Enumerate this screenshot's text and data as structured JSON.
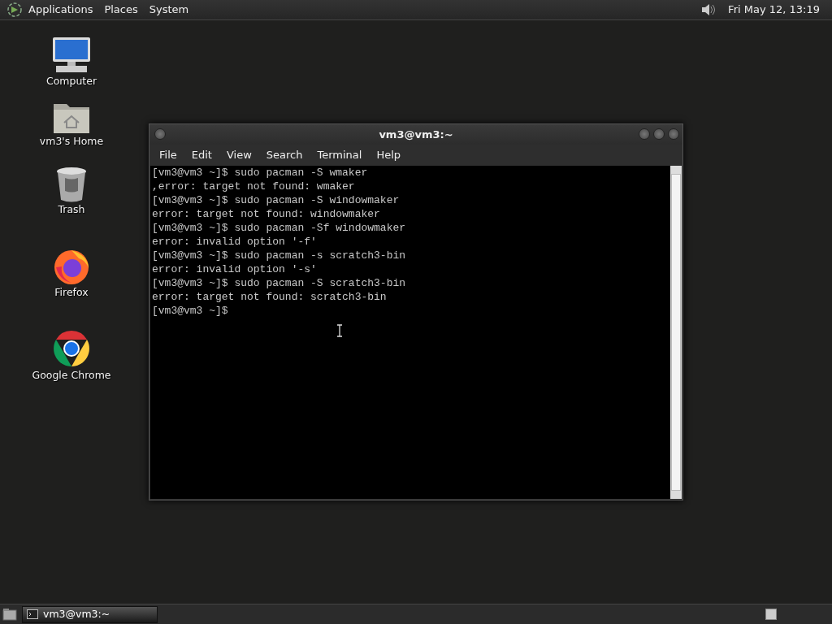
{
  "top_panel": {
    "menus": [
      "Applications",
      "Places",
      "System"
    ],
    "clock": "Fri May 12, 13:19"
  },
  "desktop_icons": [
    {
      "kind": "computer",
      "label": "Computer"
    },
    {
      "kind": "home",
      "label": "vm3's Home"
    },
    {
      "kind": "trash",
      "label": "Trash"
    },
    {
      "kind": "firefox",
      "label": "Firefox"
    },
    {
      "kind": "chrome",
      "label": "Google Chrome"
    }
  ],
  "terminal": {
    "title": "vm3@vm3:~",
    "menu": [
      "File",
      "Edit",
      "View",
      "Search",
      "Terminal",
      "Help"
    ],
    "lines": [
      "[vm3@vm3 ~]$ sudo pacman -S wmaker",
      ",error: target not found: wmaker",
      "[vm3@vm3 ~]$ sudo pacman -S windowmaker",
      "error: target not found: windowmaker",
      "[vm3@vm3 ~]$ sudo pacman -Sf windowmaker",
      "error: invalid option '-f'",
      "[vm3@vm3 ~]$ sudo pacman -s scratch3-bin",
      "error: invalid option '-s'",
      "[vm3@vm3 ~]$ sudo pacman -S scratch3-bin",
      "error: target not found: scratch3-bin",
      "[vm3@vm3 ~]$"
    ]
  },
  "taskbar": {
    "tasks": [
      {
        "label": "vm3@vm3:~",
        "selected": true
      }
    ]
  }
}
